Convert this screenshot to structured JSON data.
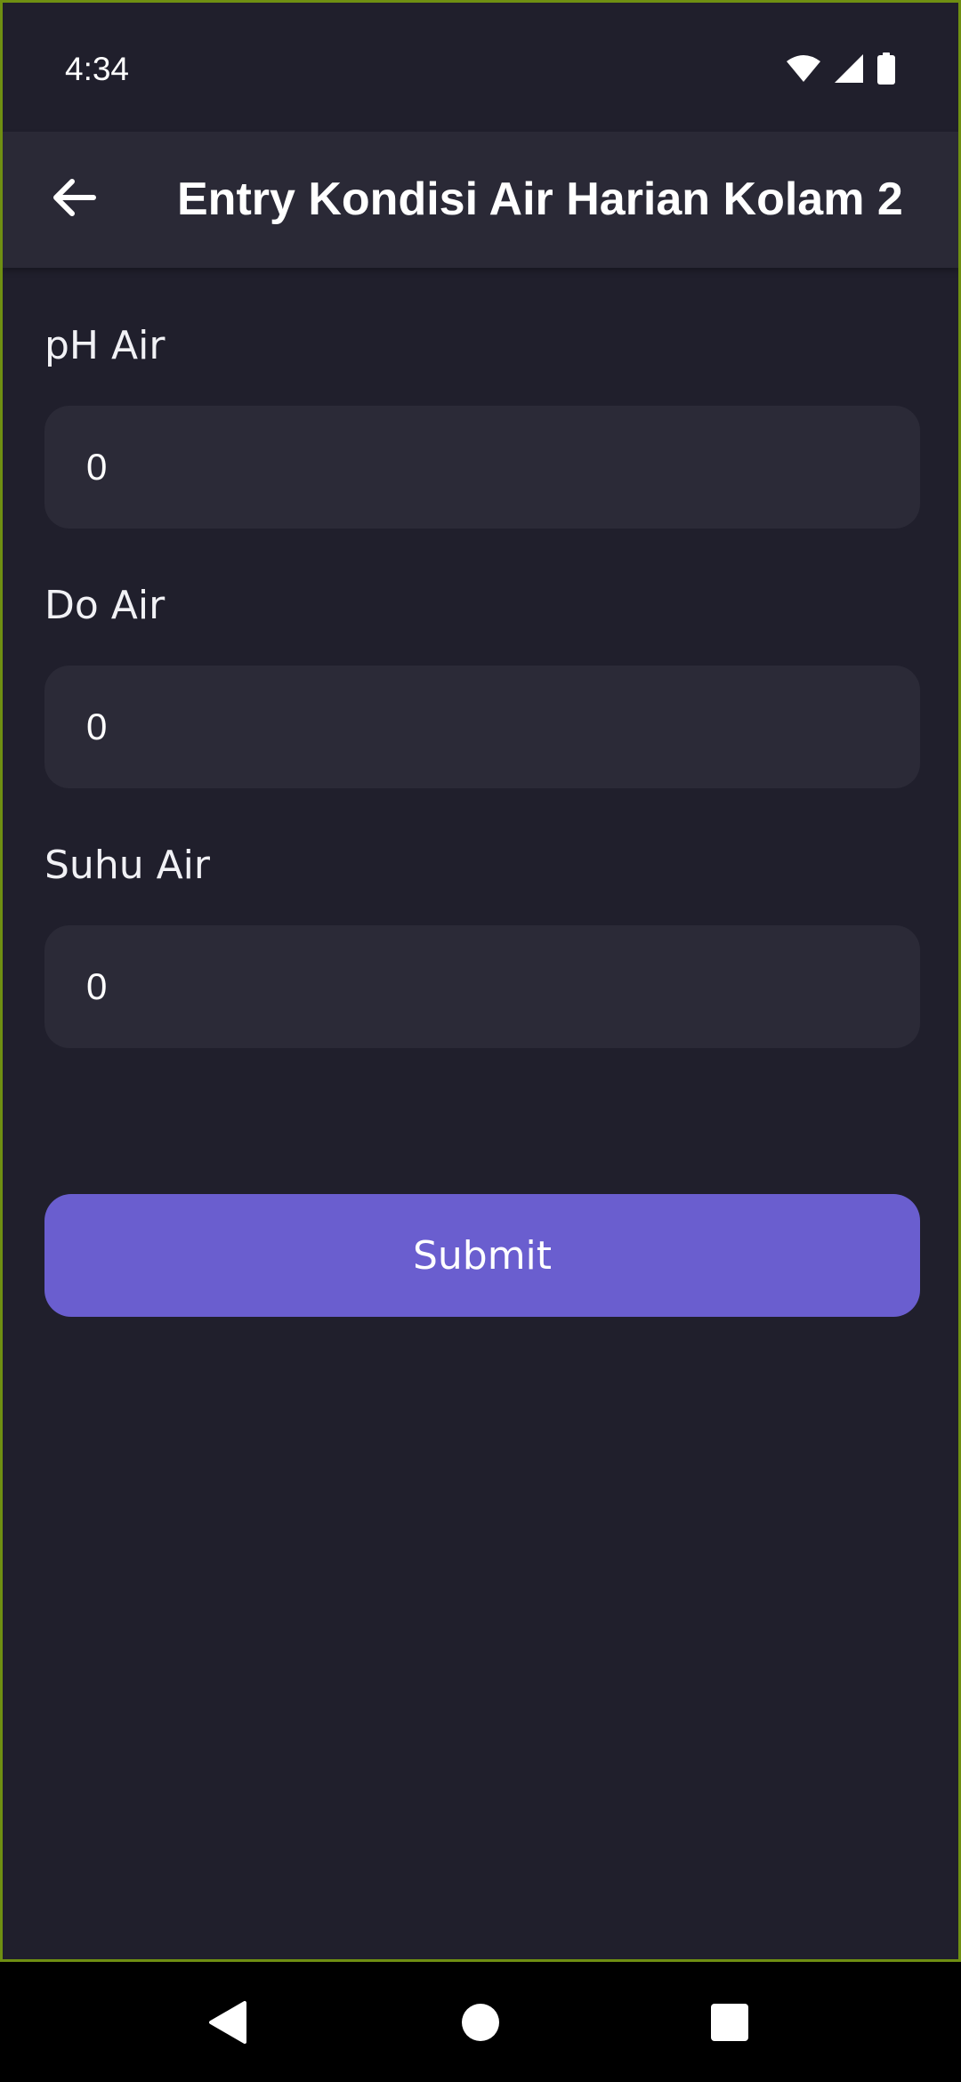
{
  "status_bar": {
    "time": "4:34",
    "icons": [
      "wifi-icon",
      "cellular-signal-icon",
      "battery-icon"
    ]
  },
  "app_bar": {
    "back_icon": "arrow-left-icon",
    "title": "Entry Kondisi Air Harian Kolam 2"
  },
  "form": {
    "fields": [
      {
        "label": "pH Air",
        "value": "0"
      },
      {
        "label": "Do Air",
        "value": "0"
      },
      {
        "label": "Suhu Air",
        "value": "0"
      }
    ],
    "submit_label": "Submit"
  },
  "nav_bar": {
    "icons": [
      "back-triangle-icon",
      "home-circle-icon",
      "recents-square-icon"
    ]
  },
  "colors": {
    "background": "#201f2c",
    "app_bar": "#2a2936",
    "input_background": "#2b2a37",
    "accent": "#6a5ecf",
    "text": "#ffffff"
  }
}
